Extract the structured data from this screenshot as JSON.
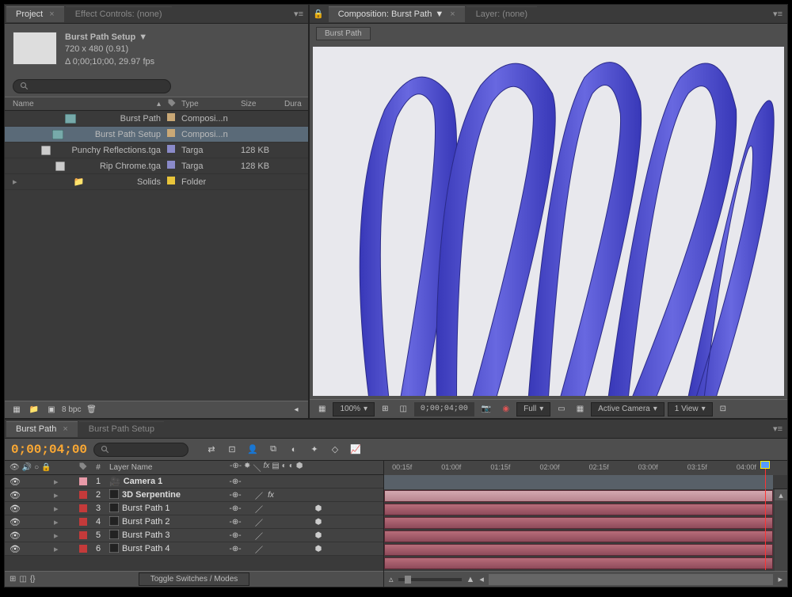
{
  "project": {
    "tab": "Project",
    "effectsTab": "Effect Controls: (none)",
    "compName": "Burst Path Setup",
    "dimensions": "720 x 480 (0.91)",
    "duration": "Δ 0;00;10;00, 29.97 fps",
    "searchPlaceholder": "",
    "columns": {
      "name": "Name",
      "type": "Type",
      "size": "Size",
      "dur": "Dura"
    },
    "items": [
      {
        "name": "Burst Path",
        "type": "Composi...n",
        "size": "",
        "icon": "comp",
        "color": "#c9a876"
      },
      {
        "name": "Burst Path Setup",
        "type": "Composi...n",
        "size": "",
        "icon": "comp",
        "color": "#c9a876",
        "selected": true
      },
      {
        "name": "Punchy Reflections.tga",
        "type": "Targa",
        "size": "128 KB",
        "icon": "file",
        "color": "#8a8ac9"
      },
      {
        "name": "Rip Chrome.tga",
        "type": "Targa",
        "size": "128 KB",
        "icon": "file",
        "color": "#8a8ac9"
      },
      {
        "name": "Solids",
        "type": "Folder",
        "size": "",
        "icon": "folder",
        "color": "#e8c43a",
        "expandable": true
      }
    ],
    "footer": {
      "bpc": "8 bpc"
    }
  },
  "composition": {
    "tab": "Composition: Burst Path",
    "layerTab": "Layer: (none)",
    "subTab": "Burst Path",
    "footer": {
      "zoom": "100%",
      "time": "0;00;04;00",
      "res": "Full",
      "camera": "Active Camera",
      "views": "1 View"
    }
  },
  "timeline": {
    "tabs": [
      "Burst Path",
      "Burst Path Setup"
    ],
    "activeTab": 0,
    "timecode": "0;00;04;00",
    "columns": {
      "num": "#",
      "name": "Layer Name"
    },
    "ruler": [
      "00:15f",
      "01:00f",
      "01:15f",
      "02:00f",
      "02:15f",
      "03:00f",
      "03:15f",
      "04:00f"
    ],
    "layers": [
      {
        "num": "1",
        "name": "Camera 1",
        "color": "#e89aa8",
        "icon": "camera",
        "bold": true,
        "sw": [
          "-e-"
        ],
        "camera": true
      },
      {
        "num": "2",
        "name": "3D Serpentine",
        "color": "#c43a3a",
        "icon": "solid",
        "bold": true,
        "sw": [
          "-e-",
          "/",
          "fx"
        ]
      },
      {
        "num": "3",
        "name": "Burst Path 1",
        "color": "#c43a3a",
        "icon": "solid",
        "sw": [
          "-e-",
          "/"
        ],
        "cube": true
      },
      {
        "num": "4",
        "name": "Burst Path 2",
        "color": "#c43a3a",
        "icon": "solid",
        "sw": [
          "-e-",
          "/"
        ],
        "cube": true
      },
      {
        "num": "5",
        "name": "Burst Path 3",
        "color": "#c43a3a",
        "icon": "solid",
        "sw": [
          "-e-",
          "/"
        ],
        "cube": true
      },
      {
        "num": "6",
        "name": "Burst Path 4",
        "color": "#c43a3a",
        "icon": "solid",
        "sw": [
          "-e-",
          "/"
        ],
        "cube": true
      }
    ],
    "toggleBtn": "Toggle Switches / Modes"
  }
}
